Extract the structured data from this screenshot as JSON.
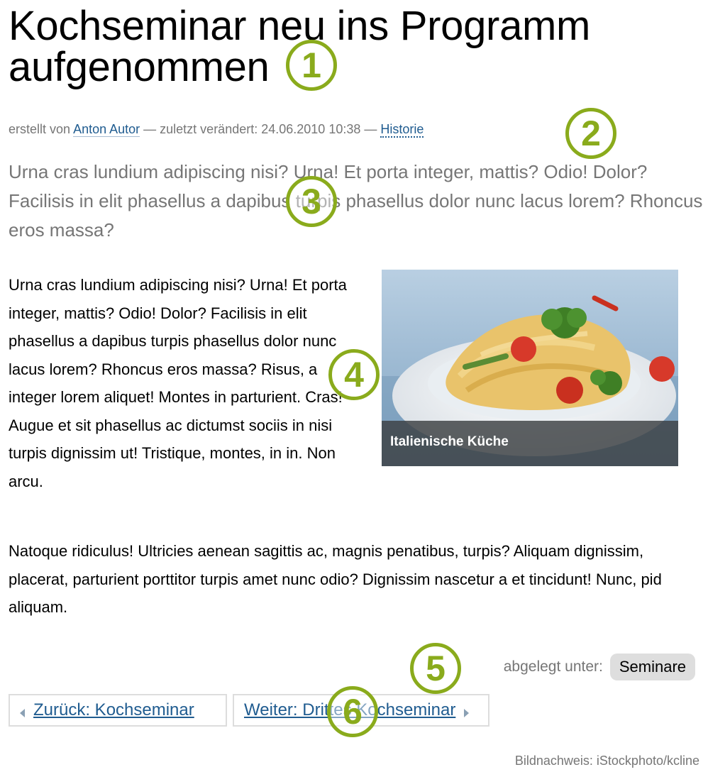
{
  "article": {
    "title": "Kochseminar neu ins Programm aufgenommen",
    "byline": {
      "created_by_label": "erstellt von",
      "author": "Anton Autor",
      "modified_label": "— zuletzt verändert: 24.06.2010 10:38 —",
      "history_link": "Historie"
    },
    "lead": "Urna cras lundium adipiscing nisi? Urna! Et porta integer, mattis? Odio! Dolor? Facilisis in elit phasellus a dapibus turpis phasellus dolor nunc lacus lorem? Rhoncus eros massa?",
    "body_paragraph_1": "Urna cras lundium adipiscing nisi? Urna! Et porta integer, mattis? Odio! Dolor? Facilisis in elit phasellus a dapibus turpis phasellus dolor nunc lacus lorem? Rhoncus eros massa? Risus, a integer lorem aliquet! Montes in parturient. Cras! Augue et sit phasellus ac dictumst sociis in nisi turpis dignissim ut! Tristique, montes, in in. Non arcu.",
    "body_paragraph_2": "Natoque ridiculus! Ultricies aenean sagittis ac, magnis penatibus, turpis? Aliquam dignissim, placerat, parturient porttitor turpis amet nunc odio? Dignissim nascetur a et tincidunt! Nunc, pid aliquam.",
    "image": {
      "caption": "Italienische Küche"
    },
    "categories": {
      "label": "abgelegt unter:",
      "tags": [
        "Seminare"
      ]
    },
    "navigation": {
      "previous": "Zurück: Kochseminar",
      "next": "Weiter: Drittes Kochseminar"
    },
    "credit": "Bildnachweis: iStockphoto/kcline"
  },
  "markers": [
    "1",
    "2",
    "3",
    "4",
    "5",
    "6"
  ],
  "colors": {
    "marker_green": "#8aab1c",
    "link_blue": "#205c90",
    "meta_gray": "#767676",
    "tag_bg": "#dedede"
  }
}
